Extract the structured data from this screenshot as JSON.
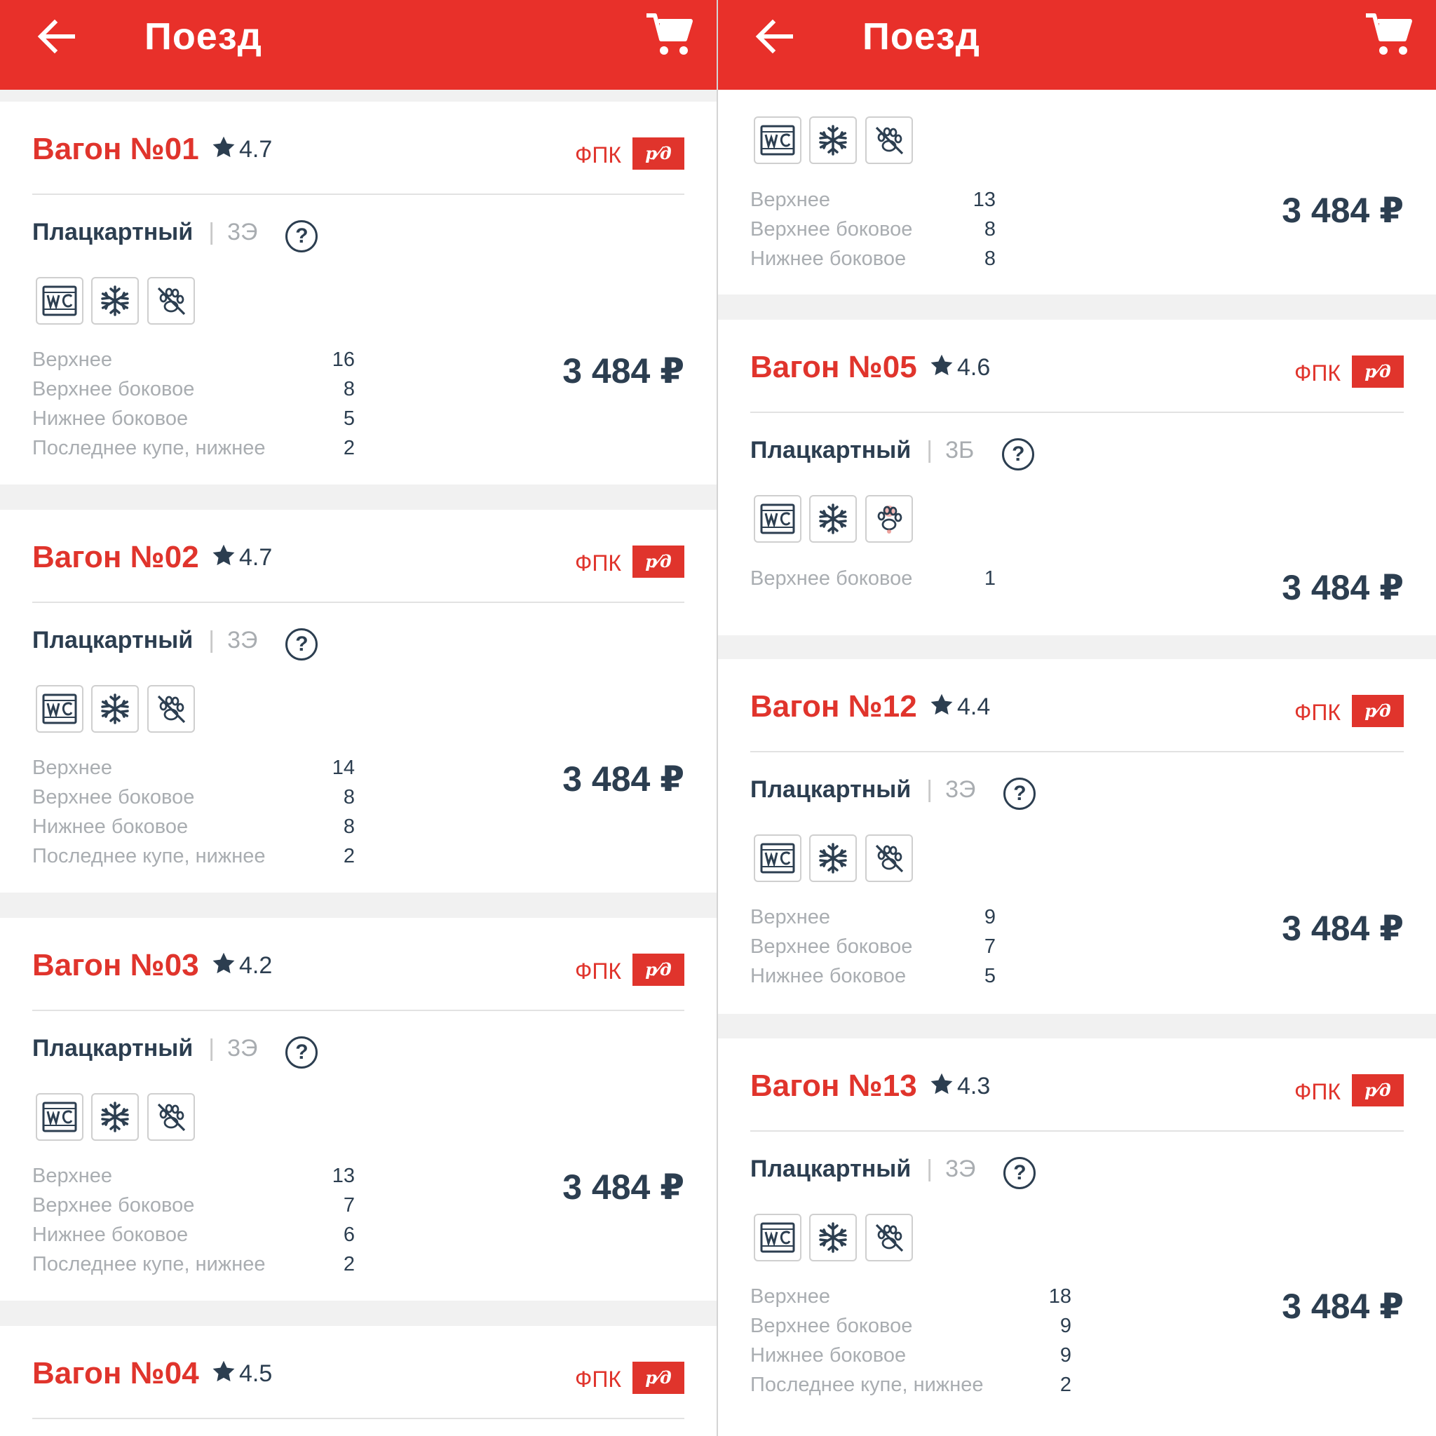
{
  "colors": {
    "brand": "#e8302a",
    "text": "#2c3e50",
    "muted": "#a9adb1",
    "background": "#f1f1f1"
  },
  "left": {
    "appbar": {
      "title": "Поезд",
      "back_icon": "arrow-left-icon",
      "cart_icon": "shopping-cart-icon"
    },
    "cars": [
      {
        "title": "Вагон №01",
        "rating": "4.7",
        "carrier": "ФПК",
        "logo": "р⁄д",
        "class_name": "Плацкартный",
        "class_code": "3Э",
        "seats": [
          {
            "label": "Верхнее",
            "count": "16"
          },
          {
            "label": "Верхнее боковое",
            "count": "8"
          },
          {
            "label": "Нижнее боковое",
            "count": "5"
          },
          {
            "label": "Последнее купе, нижнее",
            "count": "2"
          }
        ],
        "price": "3 484 ₽"
      },
      {
        "title": "Вагон №02",
        "rating": "4.7",
        "carrier": "ФПК",
        "logo": "р⁄д",
        "class_name": "Плацкартный",
        "class_code": "3Э",
        "seats": [
          {
            "label": "Верхнее",
            "count": "14"
          },
          {
            "label": "Верхнее боковое",
            "count": "8"
          },
          {
            "label": "Нижнее боковое",
            "count": "8"
          },
          {
            "label": "Последнее купе, нижнее",
            "count": "2"
          }
        ],
        "price": "3 484 ₽"
      },
      {
        "title": "Вагон №03",
        "rating": "4.2",
        "carrier": "ФПК",
        "logo": "р⁄д",
        "class_name": "Плацкартный",
        "class_code": "3Э",
        "seats": [
          {
            "label": "Верхнее",
            "count": "13"
          },
          {
            "label": "Верхнее боковое",
            "count": "7"
          },
          {
            "label": "Нижнее боковое",
            "count": "6"
          },
          {
            "label": "Последнее купе, нижнее",
            "count": "2"
          }
        ],
        "price": "3 484 ₽"
      },
      {
        "title": "Вагон №04",
        "rating": "4.5",
        "carrier": "ФПК",
        "logo": "р⁄д"
      }
    ]
  },
  "right": {
    "appbar": {
      "title": "Поезд",
      "back_icon": "arrow-left-icon",
      "cart_icon": "shopping-cart-icon"
    },
    "partial_car": {
      "seats": [
        {
          "label": "Верхнее",
          "count": "13"
        },
        {
          "label": "Верхнее боковое",
          "count": "8"
        },
        {
          "label": "Нижнее боковое",
          "count": "8"
        }
      ],
      "price": "3 484 ₽"
    },
    "cars": [
      {
        "title": "Вагон №05",
        "rating": "4.6",
        "carrier": "ФПК",
        "logo": "р⁄д",
        "class_name": "Плацкартный",
        "class_code": "3Б",
        "seats": [
          {
            "label": "Верхнее боковое",
            "count": "1"
          }
        ],
        "price": "3 484 ₽"
      },
      {
        "title": "Вагон №12",
        "rating": "4.4",
        "carrier": "ФПК",
        "logo": "р⁄д",
        "class_name": "Плацкартный",
        "class_code": "3Э",
        "seats": [
          {
            "label": "Верхнее",
            "count": "9"
          },
          {
            "label": "Верхнее боковое",
            "count": "7"
          },
          {
            "label": "Нижнее боковое",
            "count": "5"
          }
        ],
        "price": "3 484 ₽"
      },
      {
        "title": "Вагон №13",
        "rating": "4.3",
        "carrier": "ФПК",
        "logo": "р⁄д",
        "class_name": "Плацкартный",
        "class_code": "3Э",
        "seats": [
          {
            "label": "Верхнее",
            "count": "18"
          },
          {
            "label": "Верхнее боковое",
            "count": "9"
          },
          {
            "label": "Нижнее боковое",
            "count": "9"
          },
          {
            "label": "Последнее купе, нижнее",
            "count": "2"
          }
        ],
        "price": "3 484 ₽"
      }
    ]
  },
  "amenity_icons": {
    "wc": "wc-icon",
    "ac": "snowflake-icon",
    "no_pets": "no-pets-icon",
    "pets": "pets-allowed-icon",
    "help": "help-icon"
  },
  "help_glyph": "?"
}
